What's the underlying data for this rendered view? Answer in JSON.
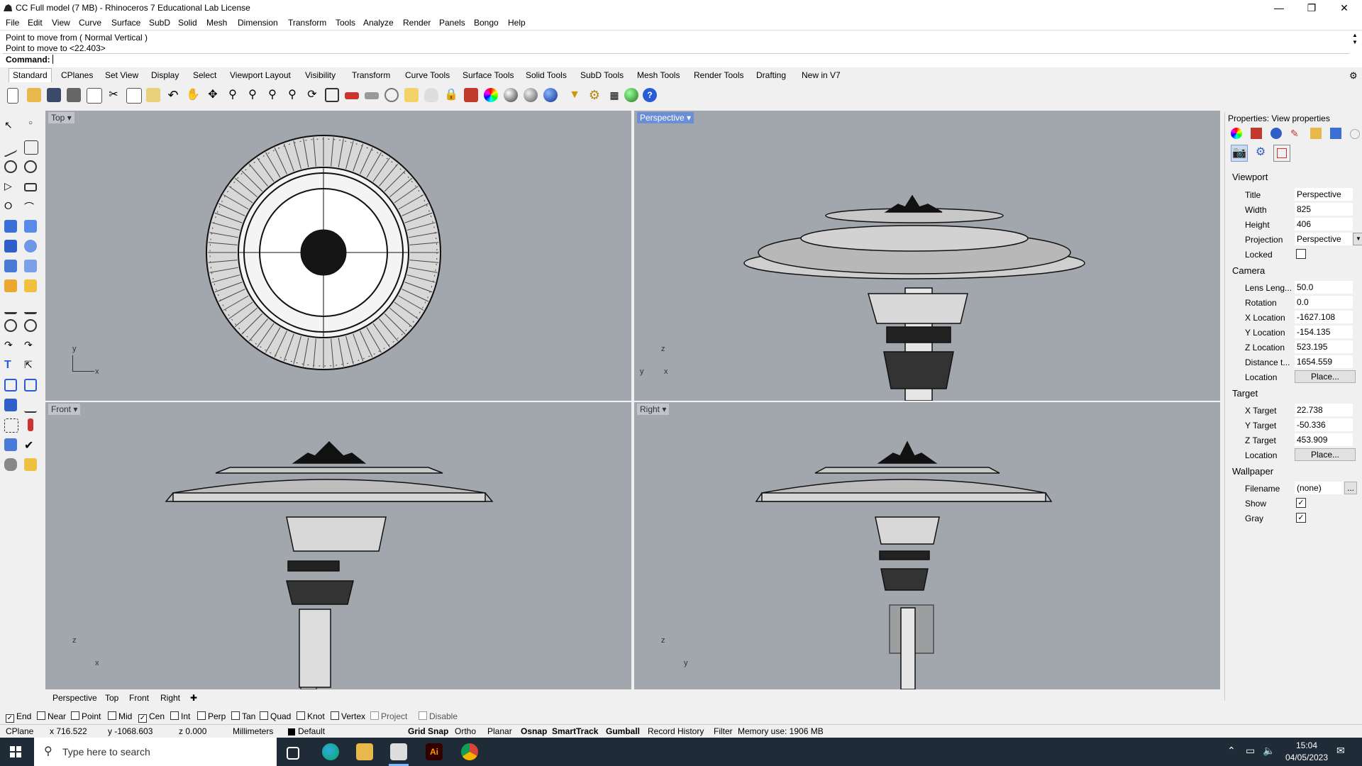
{
  "window": {
    "title": "CC Full model (7 MB) - Rhinoceros 7 Educational Lab License",
    "minimize_icon": "minimize-icon",
    "maximize_icon": "restore-icon",
    "close_icon": "close-icon"
  },
  "menu": [
    "File",
    "Edit",
    "View",
    "Curve",
    "Surface",
    "SubD",
    "Solid",
    "Mesh",
    "Dimension",
    "Transform",
    "Tools",
    "Analyze",
    "Render",
    "Panels",
    "Bongo",
    "Help"
  ],
  "command": {
    "history_line1": "Point to move from ( Normal  Vertical )",
    "history_line2": "Point to move to <22.403>",
    "prompt_label": "Command:"
  },
  "toolbar_tabs": [
    "Standard",
    "CPlanes",
    "Set View",
    "Display",
    "Select",
    "Viewport Layout",
    "Visibility",
    "Transform",
    "Curve Tools",
    "Surface Tools",
    "Solid Tools",
    "SubD Tools",
    "Mesh Tools",
    "Render Tools",
    "Drafting",
    "New in V7"
  ],
  "active_tab": "Standard",
  "toolbar_icons": [
    "new-icon",
    "open-icon",
    "save-icon",
    "print-icon",
    "import-icon",
    "cut-icon",
    "copy-icon",
    "paste-icon",
    "undo-icon",
    "pan-icon",
    "rotate-view-icon",
    "zoom-icon",
    "zoom-window-icon",
    "zoom-extents-icon",
    "zoom-selected-icon",
    "rotate-camera-icon",
    "four-viewports-icon",
    "car-icon",
    "render-preview-icon",
    "gumball-icon",
    "snap-icon",
    "light-icon",
    "lock-icon",
    "paint-bucket-icon",
    "color-wheel-icon",
    "shaded-sphere-icon",
    "rendered-sphere-icon",
    "blue-sphere-icon",
    "filter-icon",
    "settings-gear-icon",
    "layer-tree-icon",
    "globe-icon",
    "help-icon"
  ],
  "viewports": {
    "top": {
      "label": "Top",
      "axis_y": "y",
      "axis_x": "x"
    },
    "perspective": {
      "label": "Perspective",
      "axis_z": "z",
      "axis_y": "y",
      "axis_x": "x"
    },
    "front": {
      "label": "Front",
      "axis_z": "z",
      "axis_x": "x"
    },
    "right": {
      "label": "Right",
      "axis_z": "z",
      "axis_y": "y"
    }
  },
  "viewport_tabs": [
    "Perspective",
    "Top",
    "Front",
    "Right"
  ],
  "osnaps": [
    {
      "label": "End",
      "checked": true
    },
    {
      "label": "Near",
      "checked": false
    },
    {
      "label": "Point",
      "checked": false
    },
    {
      "label": "Mid",
      "checked": false
    },
    {
      "label": "Cen",
      "checked": true
    },
    {
      "label": "Int",
      "checked": false
    },
    {
      "label": "Perp",
      "checked": false
    },
    {
      "label": "Tan",
      "checked": false
    },
    {
      "label": "Quad",
      "checked": false
    },
    {
      "label": "Knot",
      "checked": false
    },
    {
      "label": "Vertex",
      "checked": false
    },
    {
      "label": "Project",
      "checked": false
    },
    {
      "label": "Disable",
      "checked": false
    }
  ],
  "status": {
    "cplane": "CPlane",
    "x": "x 716.522",
    "y": "y -1068.603",
    "z": "z 0.000",
    "units": "Millimeters",
    "layer": "Default",
    "grid_snap": "Grid Snap",
    "ortho": "Ortho",
    "planar": "Planar",
    "osnap": "Osnap",
    "smarttrack": "SmartTrack",
    "gumball": "Gumball",
    "record_history": "Record History",
    "filter": "Filter",
    "memory": "Memory use: 1906 MB"
  },
  "properties": {
    "panel_title": "Properties: View properties",
    "viewport_section": "Viewport",
    "title_label": "Title",
    "title_value": "Perspective",
    "width_label": "Width",
    "width_value": "825",
    "height_label": "Height",
    "height_value": "406",
    "projection_label": "Projection",
    "projection_value": "Perspective",
    "locked_label": "Locked",
    "camera_section": "Camera",
    "lens_label": "Lens Leng...",
    "lens_value": "50.0",
    "rotation_label": "Rotation",
    "rotation_value": "0.0",
    "xloc_label": "X Location",
    "xloc_value": "-1627.108",
    "yloc_label": "Y Location",
    "yloc_value": "-154.135",
    "zloc_label": "Z Location",
    "zloc_value": "523.195",
    "distance_label": "Distance t...",
    "distance_value": "1654.559",
    "location_label": "Location",
    "place_button": "Place...",
    "target_section": "Target",
    "xtarget_label": "X Target",
    "xtarget_value": "22.738",
    "ytarget_label": "Y Target",
    "ytarget_value": "-50.336",
    "ztarget_label": "Z Target",
    "ztarget_value": "453.909",
    "target_location_label": "Location",
    "target_place_button": "Place...",
    "wallpaper_section": "Wallpaper",
    "filename_label": "Filename",
    "filename_value": "(none)",
    "browse_button": "...",
    "show_label": "Show",
    "gray_label": "Gray"
  },
  "taskbar": {
    "search_placeholder": "Type here to search",
    "time": "15:04",
    "date": "04/05/2023"
  }
}
